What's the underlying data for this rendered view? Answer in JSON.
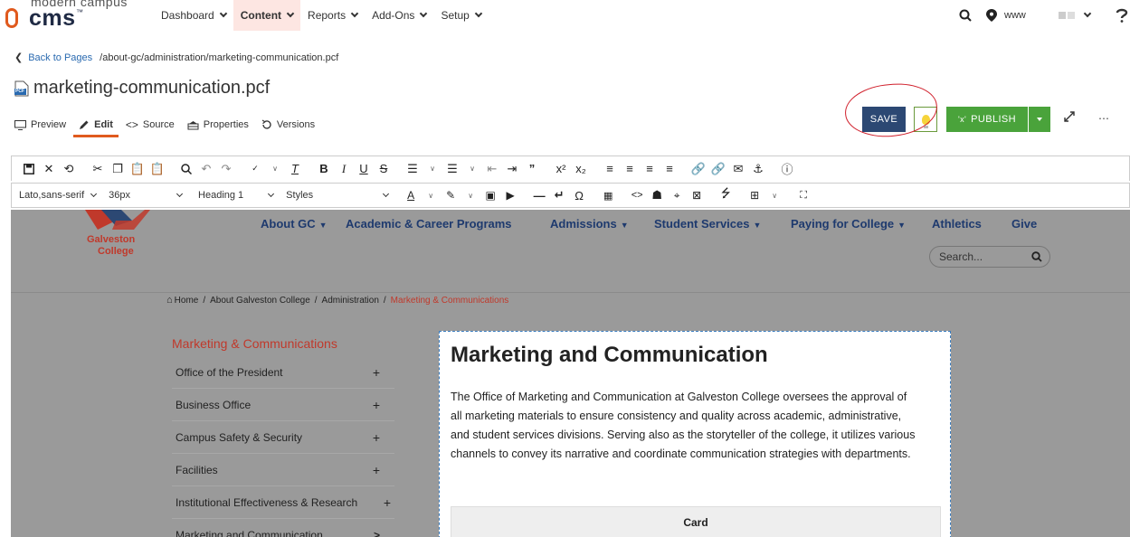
{
  "topnav": {
    "logo_top": "modern campus",
    "logo_main": "cms",
    "logo_tm": "™",
    "menu": [
      {
        "label": "Dashboard"
      },
      {
        "label": "Content"
      },
      {
        "label": "Reports"
      },
      {
        "label": "Add-Ons"
      },
      {
        "label": "Setup"
      }
    ],
    "site": "www"
  },
  "page": {
    "back_label": "Back to Pages",
    "path": "/about-gc/administration/marketing-communication.pcf",
    "filename": "marketing-communication.pcf",
    "file_badge": "PCF"
  },
  "tabs": [
    {
      "label": "Preview"
    },
    {
      "label": "Edit"
    },
    {
      "label": "Source"
    },
    {
      "label": "Properties"
    },
    {
      "label": "Versions"
    }
  ],
  "actions": {
    "save": "SAVE",
    "publish": "PUBLISH",
    "publish_icon": "'x'"
  },
  "toolbar2": {
    "font": "Lato,sans-serif",
    "size": "36px",
    "block": "Heading 1",
    "styles": "Styles"
  },
  "site": {
    "logo_line1": "Galveston",
    "logo_line2": "College",
    "nav": [
      "About GC",
      "Academic & Career Programs",
      "Admissions",
      "Student Services",
      "Paying for College",
      "Athletics",
      "Give"
    ],
    "search_placeholder": "Search...",
    "breadcrumb": [
      "Home",
      "About Galveston College",
      "Administration",
      "Marketing & Communications"
    ],
    "side_title": "Marketing & Communications",
    "side_items": [
      {
        "label": "Office of the President",
        "mark": "+"
      },
      {
        "label": "Business Office",
        "mark": "+"
      },
      {
        "label": "Campus Safety & Security",
        "mark": "+"
      },
      {
        "label": "Facilities",
        "mark": "+"
      },
      {
        "label": "Institutional Effectiveness & Research",
        "mark": "+"
      },
      {
        "label": "Marketing and Communication",
        "mark": ">"
      }
    ],
    "heading": "Marketing and Communication",
    "paragraph": "The Office of Marketing and Communication at Galveston College oversees the approval of all marketing materials to ensure consistency and quality across academic, administrative, and student services divisions. Serving also as the storyteller of the college, it utilizes various channels to convey its narrative and coordinate communication strategies with departments.",
    "card": "Card"
  },
  "colors": {
    "accent": "#e05a1e",
    "save": "#2c4873",
    "publish": "#4aa33b",
    "annotation": "#d01f2b",
    "site_nav": "#1e3a6e",
    "site_red": "#c0392b"
  }
}
